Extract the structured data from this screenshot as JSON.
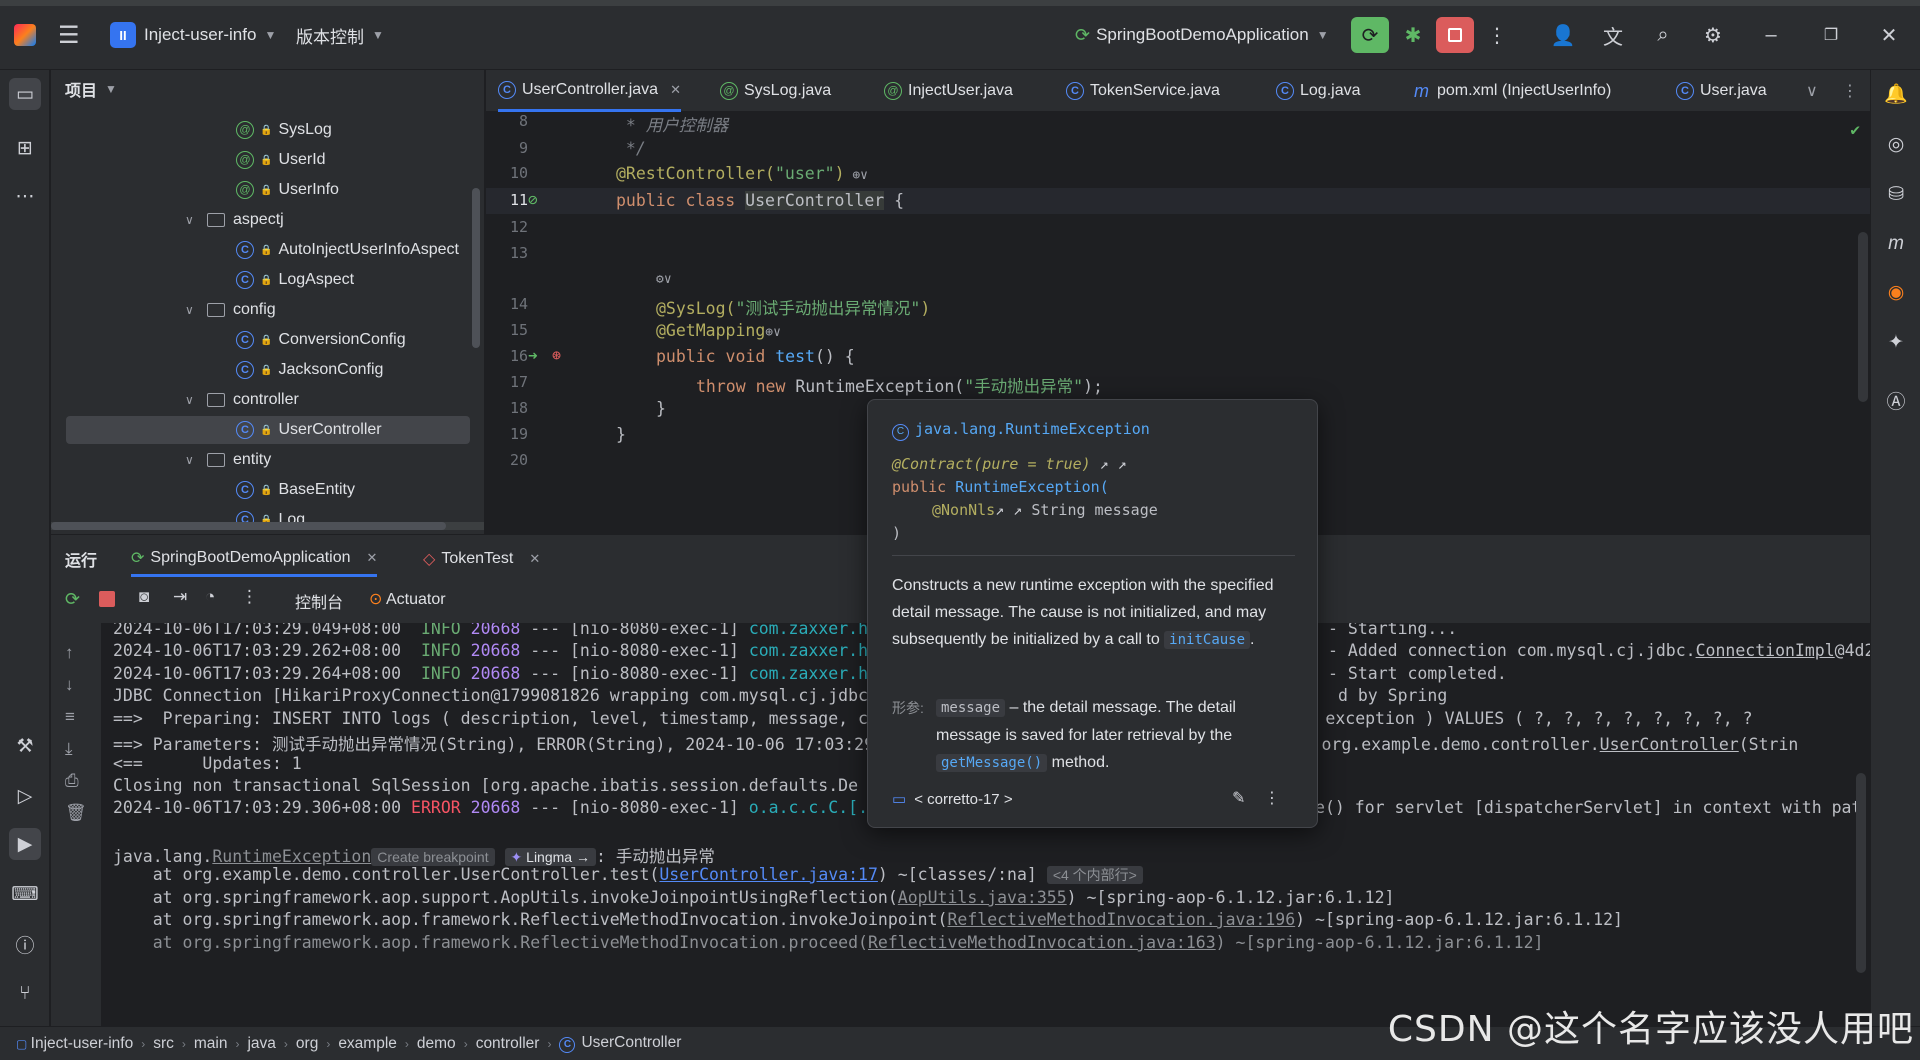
{
  "titlebar": {
    "project_name": "Inject-user-info",
    "project_badge": "II",
    "vcs_label": "版本控制",
    "run_config": "SpringBootDemoApplication"
  },
  "project_panel": {
    "title": "项目",
    "items": [
      {
        "label": "SysLog"
      },
      {
        "label": "UserId"
      },
      {
        "label": "UserInfo"
      },
      {
        "label": "aspectj"
      },
      {
        "label": "AutoInjectUserInfoAspect"
      },
      {
        "label": "LogAspect"
      },
      {
        "label": "config"
      },
      {
        "label": "ConversionConfig"
      },
      {
        "label": "JacksonConfig"
      },
      {
        "label": "controller"
      },
      {
        "label": "UserController"
      },
      {
        "label": "entity"
      },
      {
        "label": "BaseEntity"
      },
      {
        "label": "Log"
      }
    ]
  },
  "editor_tabs": [
    {
      "label": "UserController.java"
    },
    {
      "label": "SysLog.java"
    },
    {
      "label": "InjectUser.java"
    },
    {
      "label": "TokenService.java"
    },
    {
      "label": "Log.java"
    },
    {
      "label": "pom.xml (InjectUserInfo)"
    },
    {
      "label": "User.java"
    }
  ],
  "editor": {
    "line_numbers": [
      "8",
      "9",
      "10",
      "11",
      "12",
      "13",
      "14",
      "15",
      "16",
      "17",
      "18",
      "19",
      "20"
    ],
    "lines": {
      "l8": " * 用户控制器",
      "l9": " */",
      "l10_ann": "@RestController(",
      "l10_str": "\"user\"",
      "l10_end": ")",
      "l11_kw": "public class ",
      "l11_cls": "UserController",
      "l11_end": " {",
      "l14_ann": "@SysLog(",
      "l14_str": "\"测试手动抛出异常情况\"",
      "l14_end": ")",
      "l15_ann": "@GetMapping",
      "l16_kw": "public void ",
      "l16_fn": "test",
      "l16_end": "() {",
      "l17_kw": "throw new ",
      "l17_cls": "RuntimeException(",
      "l17_str": "\"手动抛出异常\"",
      "l17_end": ");",
      "l18": "}",
      "l19": "}"
    }
  },
  "popup": {
    "header": "java.lang.RuntimeException",
    "contract": "@Contract(pure = true)",
    "signature_kw": "public ",
    "signature_cls": "RuntimeException(",
    "param_ann": "@NonNls",
    "param": " String message",
    "close_paren": ")",
    "description_1": "Constructs a new runtime exception with the specified detail message. The cause is not initialized, and may subsequently be initialized by a call to",
    "description_link": "initCause",
    "description_end": ".",
    "param_label": "形参:",
    "param_name": "message",
    "param_desc_1": "– the detail message. The detail message is saved for later retrieval by the",
    "param_link": "getMessage()",
    "param_desc_2": "method.",
    "sdk": "< corretto-17 >"
  },
  "run_panel": {
    "title": "运行",
    "tabs": [
      {
        "label": "SpringBootDemoApplication"
      },
      {
        "label": "TokenTest"
      }
    ],
    "console_tab": "控制台",
    "actuator_tab": "Actuator"
  },
  "console": {
    "l1_ts": "2024-10-06T17:03:29.049+08:00",
    "l1_lvl": "INFO",
    "l1_pid": "20668",
    "l1_mid": " --- [nio-8080-exec-1] ",
    "l1_log": "com.zaxxer.h",
    "l1_tail": "- Starting...",
    "l2_ts": "2024-10-06T17:03:29.262+08:00",
    "l2_lvl": "INFO",
    "l2_pid": "20668",
    "l2_mid": " --- [nio-8080-exec-1] ",
    "l2_log": "com.zaxxer.h",
    "l2_tail": "- Added connection com.mysql.cj.jdbc.",
    "l2_link": "ConnectionImpl",
    "l2_tail2": "@4d2c",
    "l3_ts": "2024-10-06T17:03:29.264+08:00",
    "l3_lvl": "INFO",
    "l3_pid": "20668",
    "l3_mid": " --- [nio-8080-exec-1] ",
    "l3_log": "com.zaxxer.h",
    "l3_tail": "- Start completed.",
    "l4": "JDBC Connection [HikariProxyConnection@1799081826 wrapping com.mysql.cj.jdbc",
    "l4_tail": "d by Spring",
    "l5": "==>  Preparing: INSERT INTO logs ( description, level, timestamp, message, c",
    "l5_tail": "ntifier, exception ) VALUES ( ?, ?, ?, ?, ?, ?, ?, ?",
    "l6": "==> Parameters: 测试手动抛出异常情况(String), ERROR(String), 2024-10-06 17:03:29",
    "l6_tail": "tring), org.example.demo.controller.",
    "l6_link": "UserController",
    "l6_tail2": "(Strin",
    "l7": "<==      Updates: 1",
    "l8": "Closing non transactional SqlSession [org.apache.ibatis.session.defaults.De",
    "l9_ts": "2024-10-06T17:03:29.306+08:00",
    "l9_lvl": "ERROR",
    "l9_pid": "20668",
    "l9_mid": " --- [nio-8080-exec-1] ",
    "l9_log": "o.a.c.c.C.[.[.[/].[dispatcherServlet]",
    "l9_tail": "    : Servlet.service() for servlet [dispatcherServlet] in context with pat",
    "ex_prefix": "java.lang.",
    "ex_link": "RuntimeException",
    "ex_breakpoint": "Create breakpoint",
    "ex_lingma": "Lingma →",
    "ex_msg": ": 手动抛出异常",
    "st1_pre": "    at org.example.demo.controller.UserController.test(",
    "st1_link": "UserController.java:17",
    "st1_post": ") ~[classes/:na] ",
    "st1_chip": "<4 个内部行>",
    "st2_pre": "    at org.springframework.aop.support.AopUtils.invokeJoinpointUsingReflection(",
    "st2_link": "AopUtils.java:355",
    "st2_post": ") ~[spring-aop-6.1.12.jar:6.1.12]",
    "st3_pre": "    at org.springframework.aop.framework.ReflectiveMethodInvocation.invokeJoinpoint(",
    "st3_link": "ReflectiveMethodInvocation.java:196",
    "st3_post": ") ~[spring-aop-6.1.12.jar:6.1.12]",
    "st4_pre": "    at org.springframework.aop.framework.ReflectiveMethodInvocation.proceed(",
    "st4_link": "ReflectiveMethodInvocation.java:163",
    "st4_post": ") ~[spring-aop-6.1.12.jar:6.1.12]"
  },
  "statusbar": {
    "crumbs": [
      "Inject-user-info",
      "src",
      "main",
      "java",
      "org",
      "example",
      "demo",
      "controller",
      "UserController"
    ]
  },
  "watermark": "CSDN @这个名字应该没人用吧",
  "colors": {
    "accent": "#3574f0",
    "run_green": "#5fb865",
    "stop_red": "#db5c5c",
    "error": "#f75464"
  }
}
